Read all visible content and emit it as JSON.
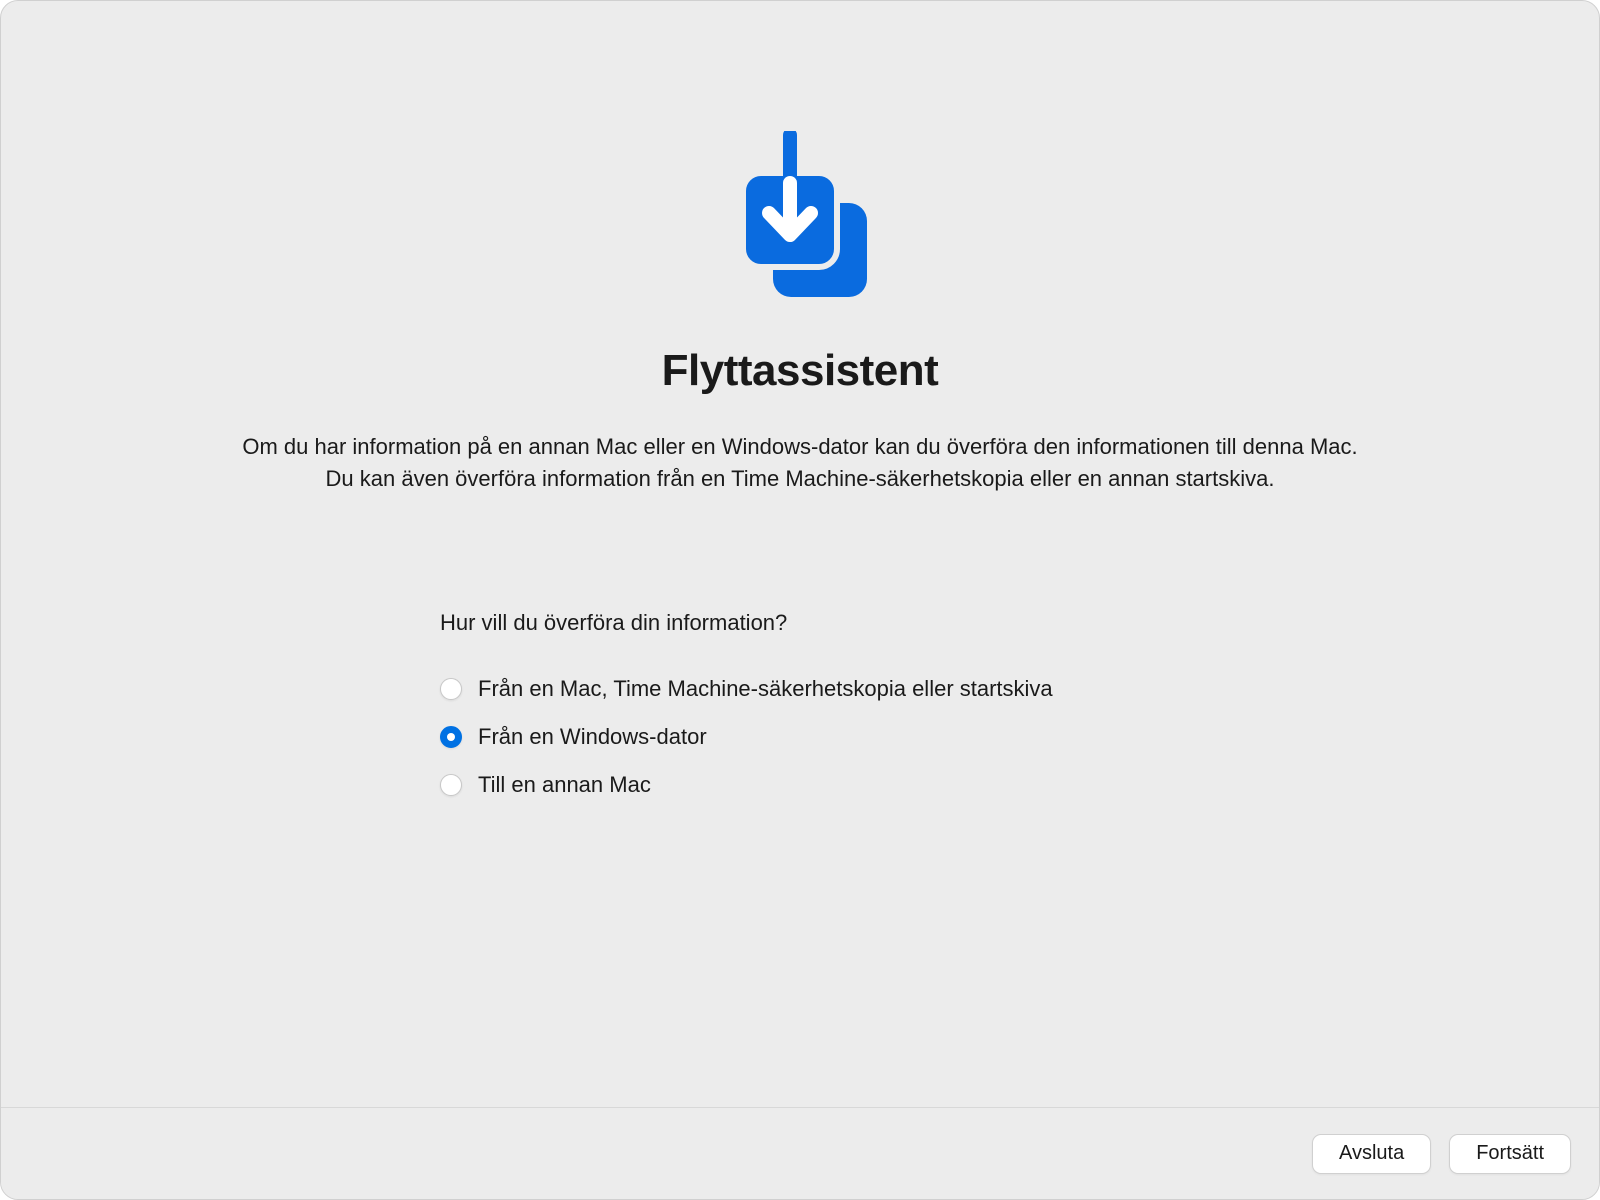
{
  "title": "Flyttassistent",
  "description": "Om du har information på en annan Mac eller en Windows-dator kan du överföra den informationen till denna Mac. Du kan även överföra information från en Time Machine-säkerhetskopia eller en annan startskiva.",
  "question": "Hur vill du överföra din information?",
  "options": [
    {
      "label": "Från en Mac, Time Machine-säkerhetskopia eller startskiva",
      "selected": false
    },
    {
      "label": "Från en Windows-dator",
      "selected": true
    },
    {
      "label": "Till en annan Mac",
      "selected": false
    }
  ],
  "buttons": {
    "quit": "Avsluta",
    "continue": "Fortsätt"
  }
}
